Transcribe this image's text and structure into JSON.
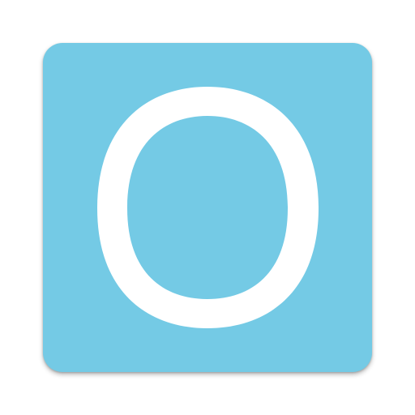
{
  "icon": {
    "letter": "O",
    "letter_icon": "letter-o-icon",
    "background_color": "#74cae5",
    "glyph_color": "#ffffff"
  }
}
